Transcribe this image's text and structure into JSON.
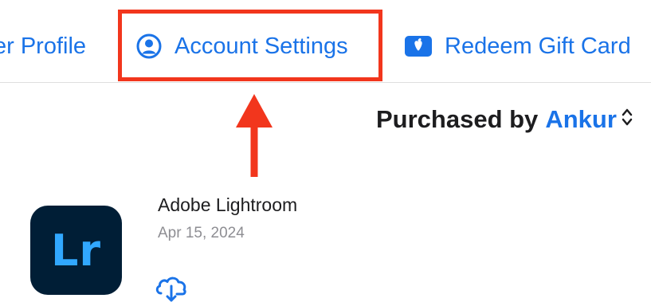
{
  "toolbar": {
    "items": [
      {
        "label": "er Profile",
        "icon": "user-icon"
      },
      {
        "label": "Account Settings",
        "icon": "person-circle-icon"
      },
      {
        "label": "Redeem Gift Card",
        "icon": "gift-card-icon"
      }
    ]
  },
  "purchased": {
    "prefix": "Purchased by",
    "name": "Ankur",
    "chevron_icon": "chevron-up-down-icon"
  },
  "app": {
    "icon_text": "Lr",
    "name": "Adobe Lightroom",
    "date": "Apr 15, 2024",
    "action_icon": "cloud-download-icon"
  },
  "colors": {
    "accent": "#1a73e8",
    "annotation": "#f2361d",
    "app_icon_bg": "#001e36",
    "app_icon_text": "#31a8ff"
  }
}
